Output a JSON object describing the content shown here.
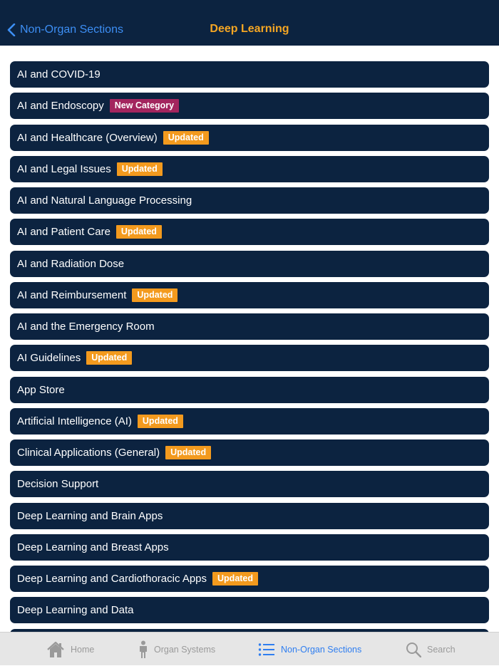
{
  "nav": {
    "back_label": "Non-Organ Sections",
    "title": "Deep Learning"
  },
  "items": [
    {
      "label": "AI and COVID-19",
      "badge": "",
      "badge_type": ""
    },
    {
      "label": "AI and Endoscopy",
      "badge": "New Category",
      "badge_type": "newcat"
    },
    {
      "label": "AI and Healthcare (Overview)",
      "badge": "Updated",
      "badge_type": "updated"
    },
    {
      "label": "AI and Legal Issues",
      "badge": "Updated",
      "badge_type": "updated"
    },
    {
      "label": "AI and Natural Language Processing",
      "badge": "",
      "badge_type": ""
    },
    {
      "label": "AI and Patient Care",
      "badge": "Updated",
      "badge_type": "updated"
    },
    {
      "label": "AI and Radiation Dose",
      "badge": "",
      "badge_type": ""
    },
    {
      "label": "AI and Reimbursement",
      "badge": "Updated",
      "badge_type": "updated"
    },
    {
      "label": "AI and the Emergency Room",
      "badge": "",
      "badge_type": ""
    },
    {
      "label": "AI Guidelines",
      "badge": "Updated",
      "badge_type": "updated"
    },
    {
      "label": "App Store",
      "badge": "",
      "badge_type": ""
    },
    {
      "label": "Artificial Intelligence (AI)",
      "badge": "Updated",
      "badge_type": "updated"
    },
    {
      "label": "Clinical Applications (General)",
      "badge": "Updated",
      "badge_type": "updated"
    },
    {
      "label": "Decision Support",
      "badge": "",
      "badge_type": ""
    },
    {
      "label": "Deep Learning and Brain Apps",
      "badge": "",
      "badge_type": ""
    },
    {
      "label": "Deep Learning and Breast Apps",
      "badge": "",
      "badge_type": ""
    },
    {
      "label": "Deep Learning and Cardiothoracic Apps",
      "badge": "Updated",
      "badge_type": "updated"
    },
    {
      "label": "Deep Learning and Data",
      "badge": "",
      "badge_type": ""
    },
    {
      "label": "",
      "badge": "",
      "badge_type": ""
    }
  ],
  "tabs": {
    "home": {
      "label": "Home",
      "icon": "home-icon"
    },
    "organ": {
      "label": "Organ Systems",
      "icon": "person-icon"
    },
    "nonorgan": {
      "label": "Non-Organ Sections",
      "icon": "list-icon"
    },
    "search": {
      "label": "Search",
      "icon": "search-icon"
    }
  },
  "colors": {
    "navbar_bg": "#0c2340",
    "accent_blue": "#3d8ff5",
    "title_orange": "#f5a623",
    "updated_badge": "#f39a1e",
    "new_category_badge": "#a3255e"
  }
}
